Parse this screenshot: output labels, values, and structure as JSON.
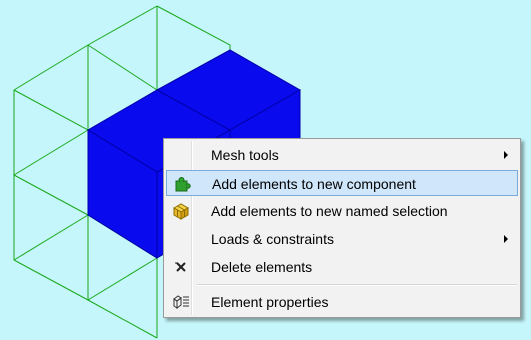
{
  "viewport": {
    "background": "#c4f6fb",
    "mesh_color": "#1aa81a",
    "selected_color": "#0a0aef"
  },
  "context_menu": {
    "items": [
      {
        "label": "Mesh tools",
        "icon": "none",
        "submenu": true
      },
      {
        "label": "Add elements to new component",
        "icon": "puzzle-piece-icon",
        "highlighted": true
      },
      {
        "label": "Add elements to new named selection",
        "icon": "yellow-cube-icon"
      },
      {
        "label": "Loads & constraints",
        "icon": "none",
        "submenu": true
      },
      {
        "label": "Delete elements",
        "icon": "delete-x-icon"
      },
      {
        "label": "Element properties",
        "icon": "element-properties-icon"
      }
    ]
  }
}
